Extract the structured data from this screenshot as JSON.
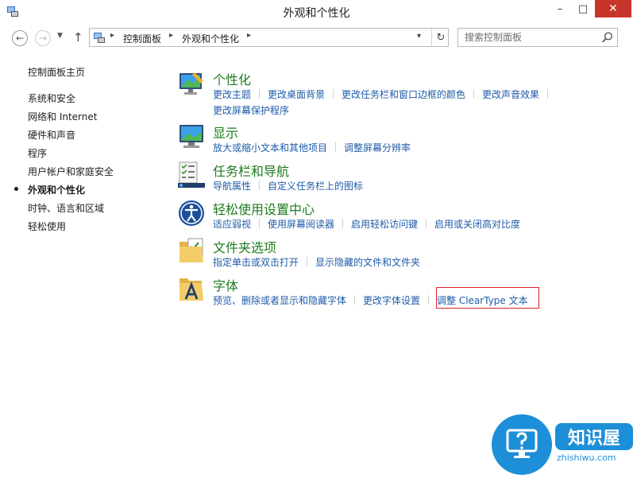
{
  "window": {
    "title": "外观和个性化",
    "minimize": "–",
    "maximize": "□",
    "close": "✕"
  },
  "nav": {
    "back": "←",
    "forward": "→",
    "recent": "▼",
    "up": "↑"
  },
  "address": {
    "breadcrumbs": [
      "控制面板",
      "外观和个性化"
    ],
    "separator": "▸",
    "dropdown": "▾",
    "refresh": "↻"
  },
  "search": {
    "placeholder": "搜索控制面板"
  },
  "sidebar": {
    "items": [
      {
        "label": "控制面板主页"
      },
      {
        "label": "系统和安全"
      },
      {
        "label": "网络和 Internet"
      },
      {
        "label": "硬件和声音"
      },
      {
        "label": "程序"
      },
      {
        "label": "用户帐户和家庭安全"
      },
      {
        "label": "外观和个性化",
        "active": true
      },
      {
        "label": "时钟、语言和区域"
      },
      {
        "label": "轻松使用"
      }
    ]
  },
  "categories": [
    {
      "title": "个性化",
      "icon": "personalization-icon",
      "links": [
        "更改主题",
        "更改桌面背景",
        "更改任务栏和窗口边框的颜色",
        "更改声音效果",
        "更改屏幕保护程序"
      ]
    },
    {
      "title": "显示",
      "icon": "display-icon",
      "links": [
        "放大或缩小文本和其他项目",
        "调整屏幕分辨率"
      ]
    },
    {
      "title": "任务栏和导航",
      "icon": "taskbar-icon",
      "links": [
        "导航属性",
        "自定义任务栏上的图标"
      ]
    },
    {
      "title": "轻松使用设置中心",
      "icon": "ease-of-access-icon",
      "links": [
        "适应弱视",
        "使用屏幕阅读器",
        "启用轻松访问键",
        "启用或关闭高对比度"
      ]
    },
    {
      "title": "文件夹选项",
      "icon": "folder-options-icon",
      "links": [
        "指定单击或双击打开",
        "显示隐藏的文件和文件夹"
      ]
    },
    {
      "title": "字体",
      "icon": "fonts-icon",
      "links": [
        "预览、删除或者显示和隐藏字体",
        "更改字体设置",
        "调整 ClearType 文本"
      ]
    }
  ],
  "watermark": {
    "brand": "知识屋",
    "url": "zhishiwu.com"
  },
  "colors": {
    "title_green": "#1e7b1e",
    "link_blue": "#1e5ba8",
    "close_red": "#c7352a",
    "highlight_red": "#dd2222",
    "watermark_blue": "#1d8fd8"
  }
}
